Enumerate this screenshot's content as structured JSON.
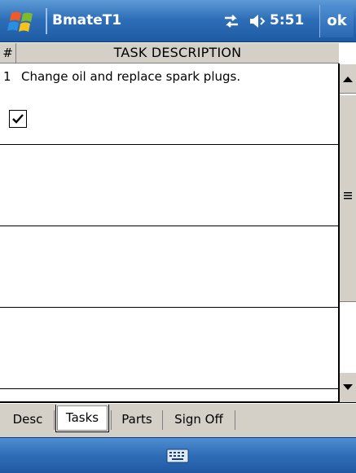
{
  "titlebar": {
    "app_title": "BmateT1",
    "clock": "5:51",
    "ok_label": "ok",
    "icons": [
      "windows-start-icon",
      "connectivity-icon",
      "volume-icon"
    ]
  },
  "grid": {
    "columns": [
      "#",
      "TASK DESCRIPTION"
    ],
    "rows": [
      {
        "number": "1",
        "description": "Change oil and replace spark plugs.",
        "checked": true
      },
      {
        "number": "",
        "description": "",
        "checked": false
      },
      {
        "number": "",
        "description": "",
        "checked": false
      },
      {
        "number": "",
        "description": "",
        "checked": false
      }
    ]
  },
  "tabs": [
    {
      "label": "Desc",
      "selected": false
    },
    {
      "label": "Tasks",
      "selected": true
    },
    {
      "label": "Parts",
      "selected": false
    },
    {
      "label": "Sign Off",
      "selected": false
    }
  ],
  "menubar": {
    "icons": [
      "keyboard-icon"
    ]
  },
  "colors": {
    "titlebar_blue": "#2f6fb8",
    "grid_header": "#d4d0c8",
    "tab_strip": "#d4d0c8"
  }
}
